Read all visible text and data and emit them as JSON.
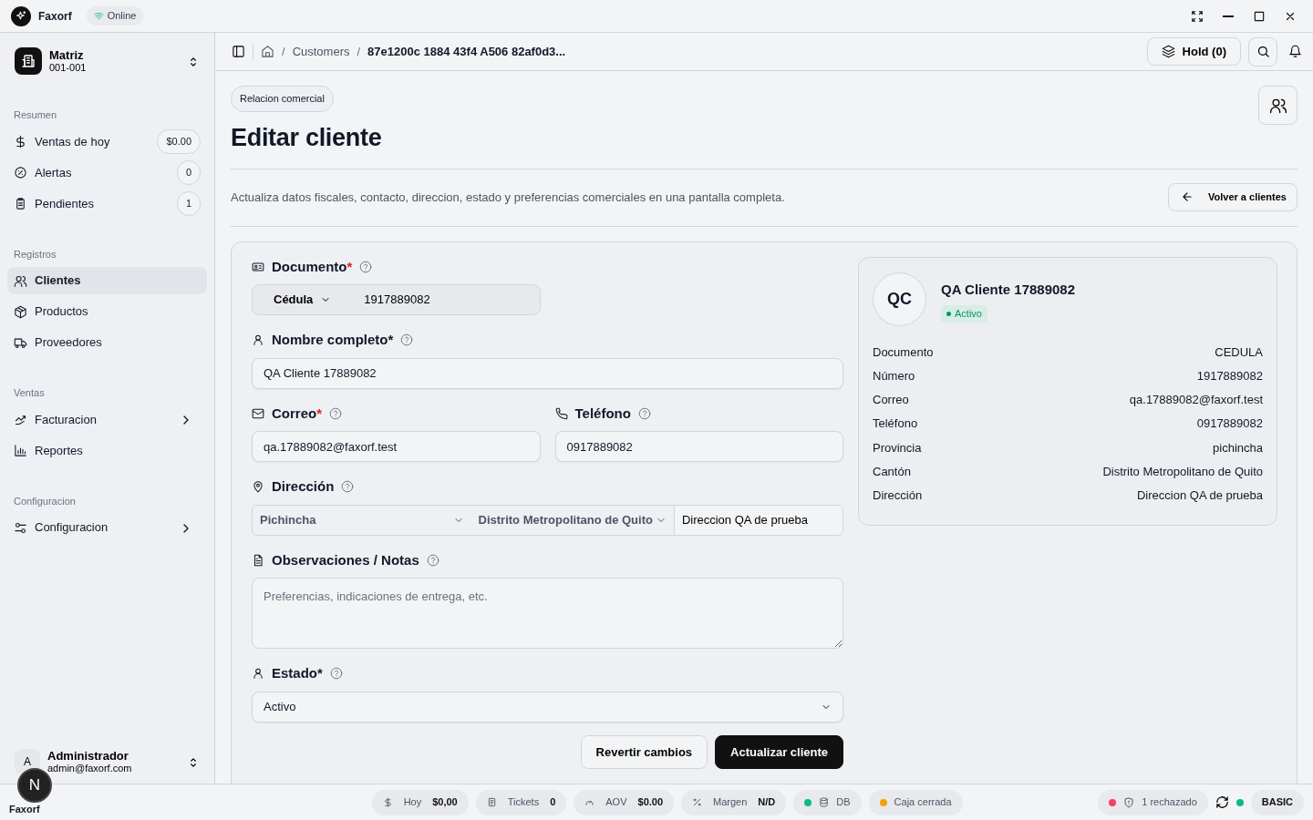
{
  "app": {
    "name": "Faxorf",
    "connection": "Online"
  },
  "branch": {
    "name": "Matriz",
    "code": "001-001"
  },
  "sidebar": {
    "sections": [
      {
        "title": "Resumen",
        "items": [
          {
            "label": "Ventas de hoy",
            "badge": "$0.00",
            "selected": false,
            "expandable": false
          },
          {
            "label": "Alertas",
            "badge": "0",
            "selected": false,
            "expandable": false
          },
          {
            "label": "Pendientes",
            "badge": "1",
            "selected": false,
            "expandable": false
          }
        ]
      },
      {
        "title": "Registros",
        "items": [
          {
            "label": "Clientes",
            "selected": true,
            "expandable": false
          },
          {
            "label": "Productos",
            "selected": false,
            "expandable": false
          },
          {
            "label": "Proveedores",
            "selected": false,
            "expandable": false
          }
        ]
      },
      {
        "title": "Ventas",
        "items": [
          {
            "label": "Facturacion",
            "selected": false,
            "expandable": true
          },
          {
            "label": "Reportes",
            "selected": false,
            "expandable": false
          }
        ]
      },
      {
        "title": "Configuracion",
        "items": [
          {
            "label": "Configuracion",
            "selected": false,
            "expandable": true
          }
        ]
      }
    ]
  },
  "user": {
    "initial": "A",
    "name": "Administrador",
    "email": "admin@faxorf.com"
  },
  "breadcrumb": [
    {
      "separator": "/",
      "label": "Customers"
    },
    {
      "separator": "/",
      "label": "87e1200c 1884 43f4 A506 82af0d3..."
    }
  ],
  "hold_button": "Hold (0)",
  "page": {
    "tag": "Relacion comercial",
    "title": "Editar cliente",
    "description": "Actualiza datos fiscales, contacto, direccion, estado y preferencias comerciales en una pantalla completa.",
    "back_button": "Volver a clientes"
  },
  "form": {
    "document": {
      "label": "Documento",
      "asterisk": "*",
      "asterisk_red": true,
      "type": "Cédula",
      "value": "1917889082"
    },
    "full_name": {
      "label": "Nombre completo",
      "asterisk": "*",
      "asterisk_red": false,
      "value": "QA Cliente 17889082"
    },
    "email": {
      "label": "Correo",
      "asterisk": "*",
      "asterisk_red": true,
      "value": "qa.17889082@faxorf.test"
    },
    "phone": {
      "label": "Teléfono",
      "value": "0917889082"
    },
    "address": {
      "label": "Dirección",
      "province": "Pichincha",
      "canton": "Distrito Metropolitano de Quito",
      "street": "Direccion QA de prueba"
    },
    "notes": {
      "label": "Observaciones / Notas",
      "placeholder": "Preferencias, indicaciones de entrega, etc."
    },
    "status": {
      "label": "Estado",
      "asterisk": "*",
      "asterisk_red": false,
      "value": "Activo"
    },
    "actions": [
      "Revertir cambios",
      "Actualizar cliente"
    ]
  },
  "summary": {
    "initials": "QC",
    "name": "QA Cliente 17889082",
    "status": "Activo",
    "active": true,
    "rows": [
      {
        "label": "Documento",
        "value": "CEDULA"
      },
      {
        "label": "Número",
        "value": "1917889082"
      },
      {
        "label": "Correo",
        "value": "qa.17889082@faxorf.test"
      },
      {
        "label": "Teléfono",
        "value": "0917889082"
      },
      {
        "label": "Provincia",
        "value": "pichincha"
      },
      {
        "label": "Cantón",
        "value": "Distrito Metropolitano de Quito"
      },
      {
        "label": "Dirección",
        "value": "Direccion QA de prueba"
      }
    ]
  },
  "status_bar": {
    "app_label": "Faxorf",
    "dev_badge": "N",
    "metrics": [
      {
        "label": "Hoy",
        "value": "$0,00"
      },
      {
        "label": "Tickets",
        "value": "0"
      },
      {
        "label": "AOV",
        "value": "$0.00"
      },
      {
        "label": "Margen",
        "value": "N/D"
      }
    ],
    "indicators": [
      {
        "label": "DB",
        "color": "#10b981"
      },
      {
        "label": "Caja cerrada",
        "color": "#f59e0b"
      }
    ],
    "right": [
      {
        "label": "1 rechazado",
        "color": "#f43f5e"
      },
      {
        "label": "BASIC",
        "color": "#10b981"
      }
    ]
  }
}
